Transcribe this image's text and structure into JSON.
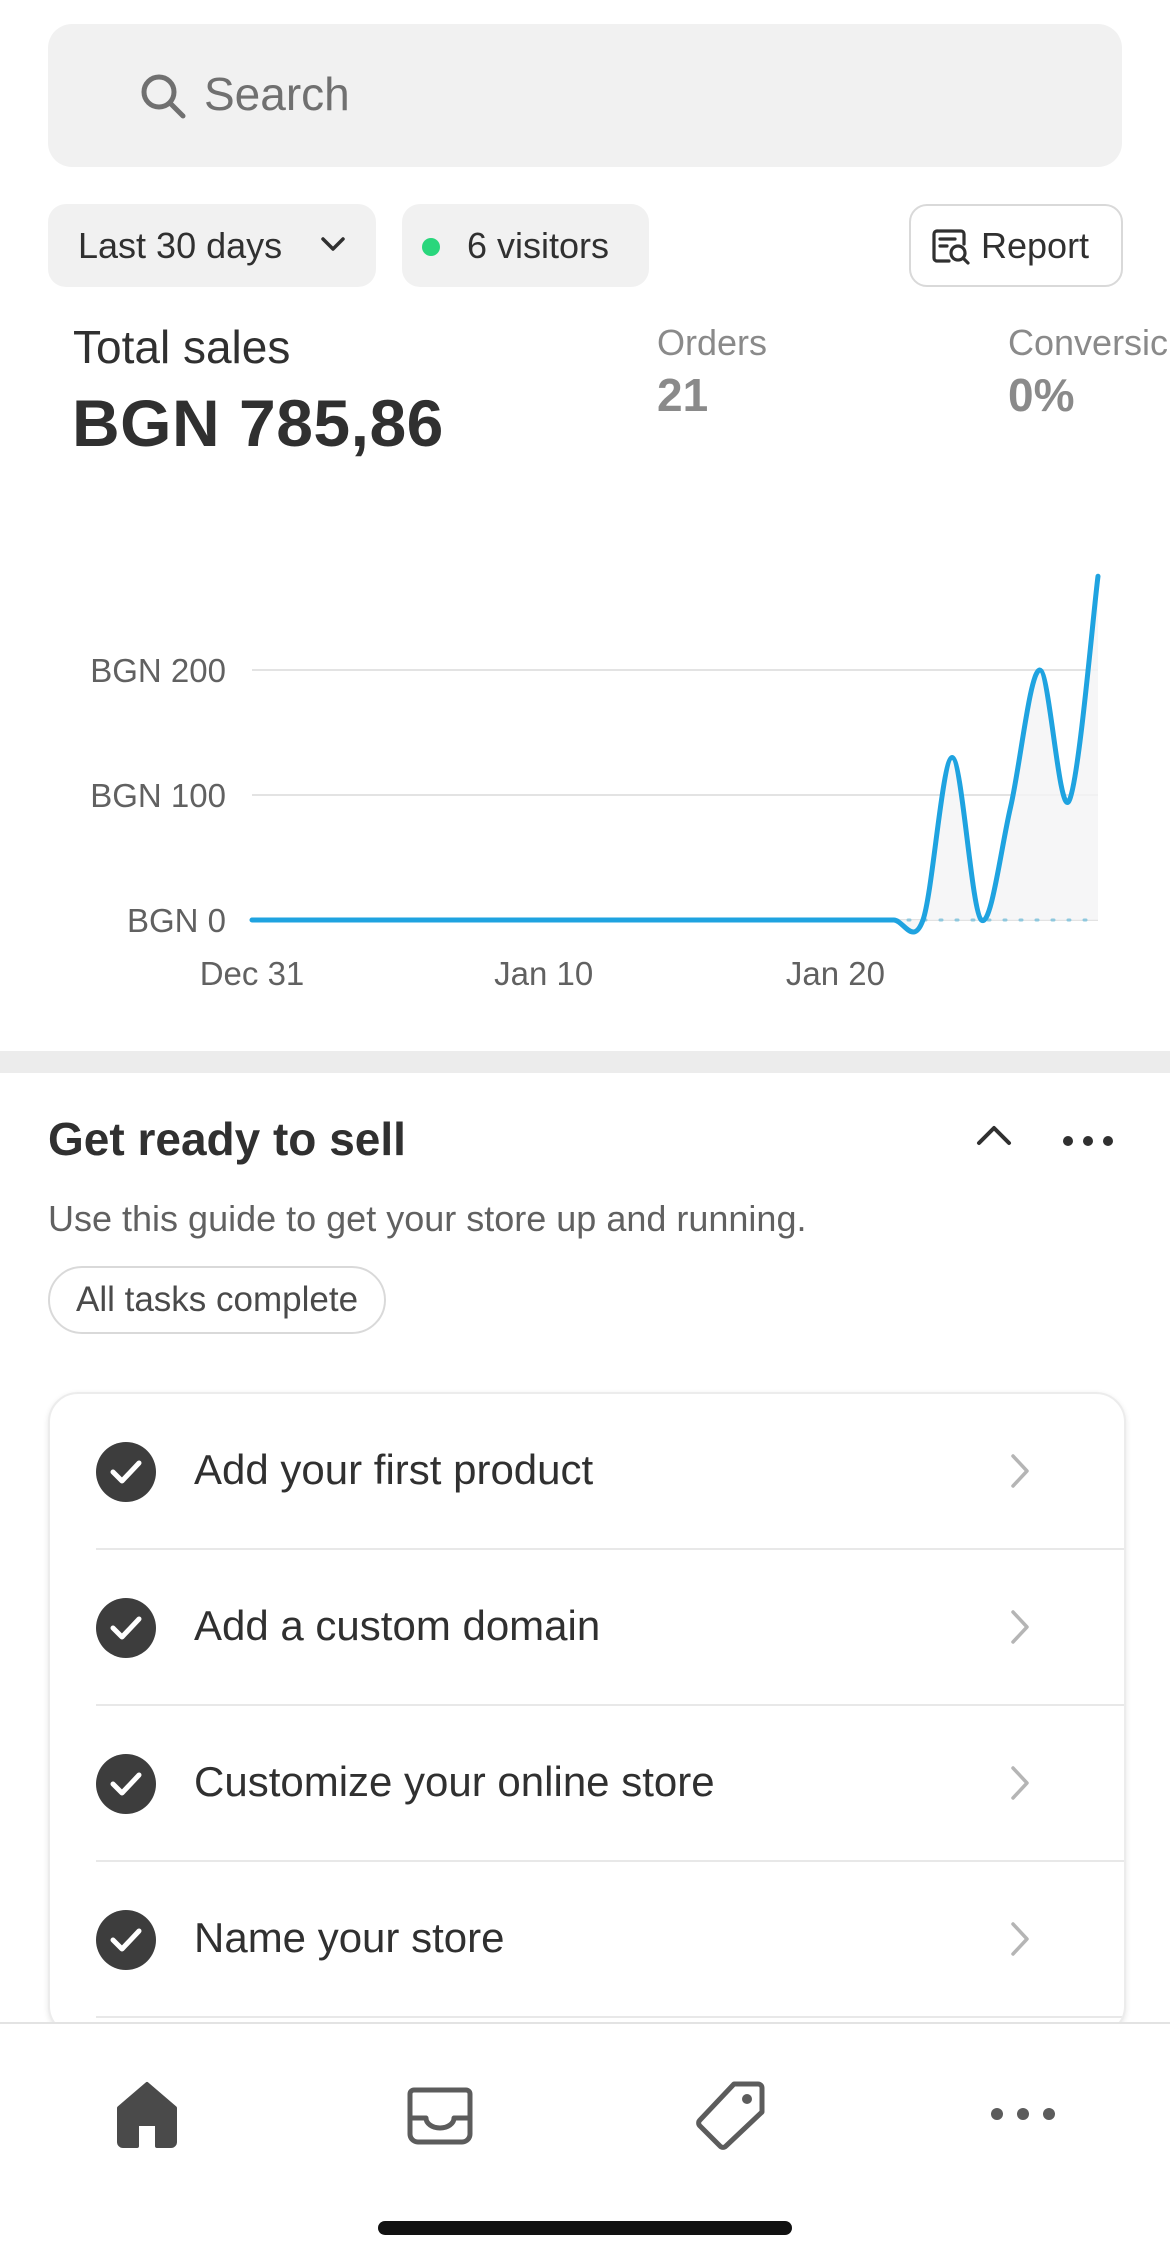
{
  "search": {
    "placeholder": "Search",
    "icon": "search-icon"
  },
  "filters": {
    "date_range": "Last 30 days",
    "visitors": "6 visitors",
    "report_label": "Report"
  },
  "metrics": {
    "total_sales_label": "Total sales",
    "total_sales_value": "BGN 785,86",
    "orders_label": "Orders",
    "orders_value": "21",
    "conversion_label": "Conversic",
    "conversion_value": "0%"
  },
  "chart_data": {
    "type": "line",
    "title": "",
    "xlabel": "",
    "ylabel": "",
    "ylim": [
      0,
      280
    ],
    "yticks": [
      0,
      100,
      200
    ],
    "ytick_labels": [
      "BGN 0",
      "BGN 100",
      "BGN 200"
    ],
    "xtick_labels": [
      "Dec 31",
      "Jan 10",
      "Jan 20"
    ],
    "x_dates": [
      "Dec 31",
      "Jan 1",
      "Jan 2",
      "Jan 3",
      "Jan 4",
      "Jan 5",
      "Jan 6",
      "Jan 7",
      "Jan 8",
      "Jan 9",
      "Jan 10",
      "Jan 11",
      "Jan 12",
      "Jan 13",
      "Jan 14",
      "Jan 15",
      "Jan 16",
      "Jan 17",
      "Jan 18",
      "Jan 19",
      "Jan 20",
      "Jan 21",
      "Jan 22",
      "Jan 23",
      "Jan 24",
      "Jan 25",
      "Jan 26",
      "Jan 27",
      "Jan 28",
      "Jan 29"
    ],
    "series": [
      {
        "color": "#1fa3e0",
        "values": [
          0,
          0,
          0,
          0,
          0,
          0,
          0,
          0,
          0,
          0,
          0,
          0,
          0,
          0,
          0,
          0,
          0,
          0,
          0,
          0,
          0,
          0,
          0,
          0,
          130,
          0,
          90,
          200,
          95,
          275
        ]
      },
      {
        "color": "#8fc8de",
        "style": "dotted",
        "values": [
          0,
          0,
          0,
          0,
          0,
          0,
          0,
          0,
          0,
          0,
          0,
          0,
          0,
          0,
          0,
          0,
          0,
          0,
          0,
          0,
          0,
          0,
          0,
          0,
          0,
          0,
          0,
          0,
          0,
          0
        ]
      }
    ],
    "grid": true
  },
  "guide": {
    "title": "Get ready to sell",
    "subtitle": "Use this guide to get your store up and running.",
    "status_badge": "All tasks complete",
    "tasks": [
      {
        "label": "Add your first product"
      },
      {
        "label": "Add a custom domain"
      },
      {
        "label": "Customize your online store"
      },
      {
        "label": "Name your store"
      }
    ]
  },
  "tabbar": {
    "items": [
      "home-icon",
      "inbox-icon",
      "tag-icon",
      "more-icon"
    ]
  }
}
